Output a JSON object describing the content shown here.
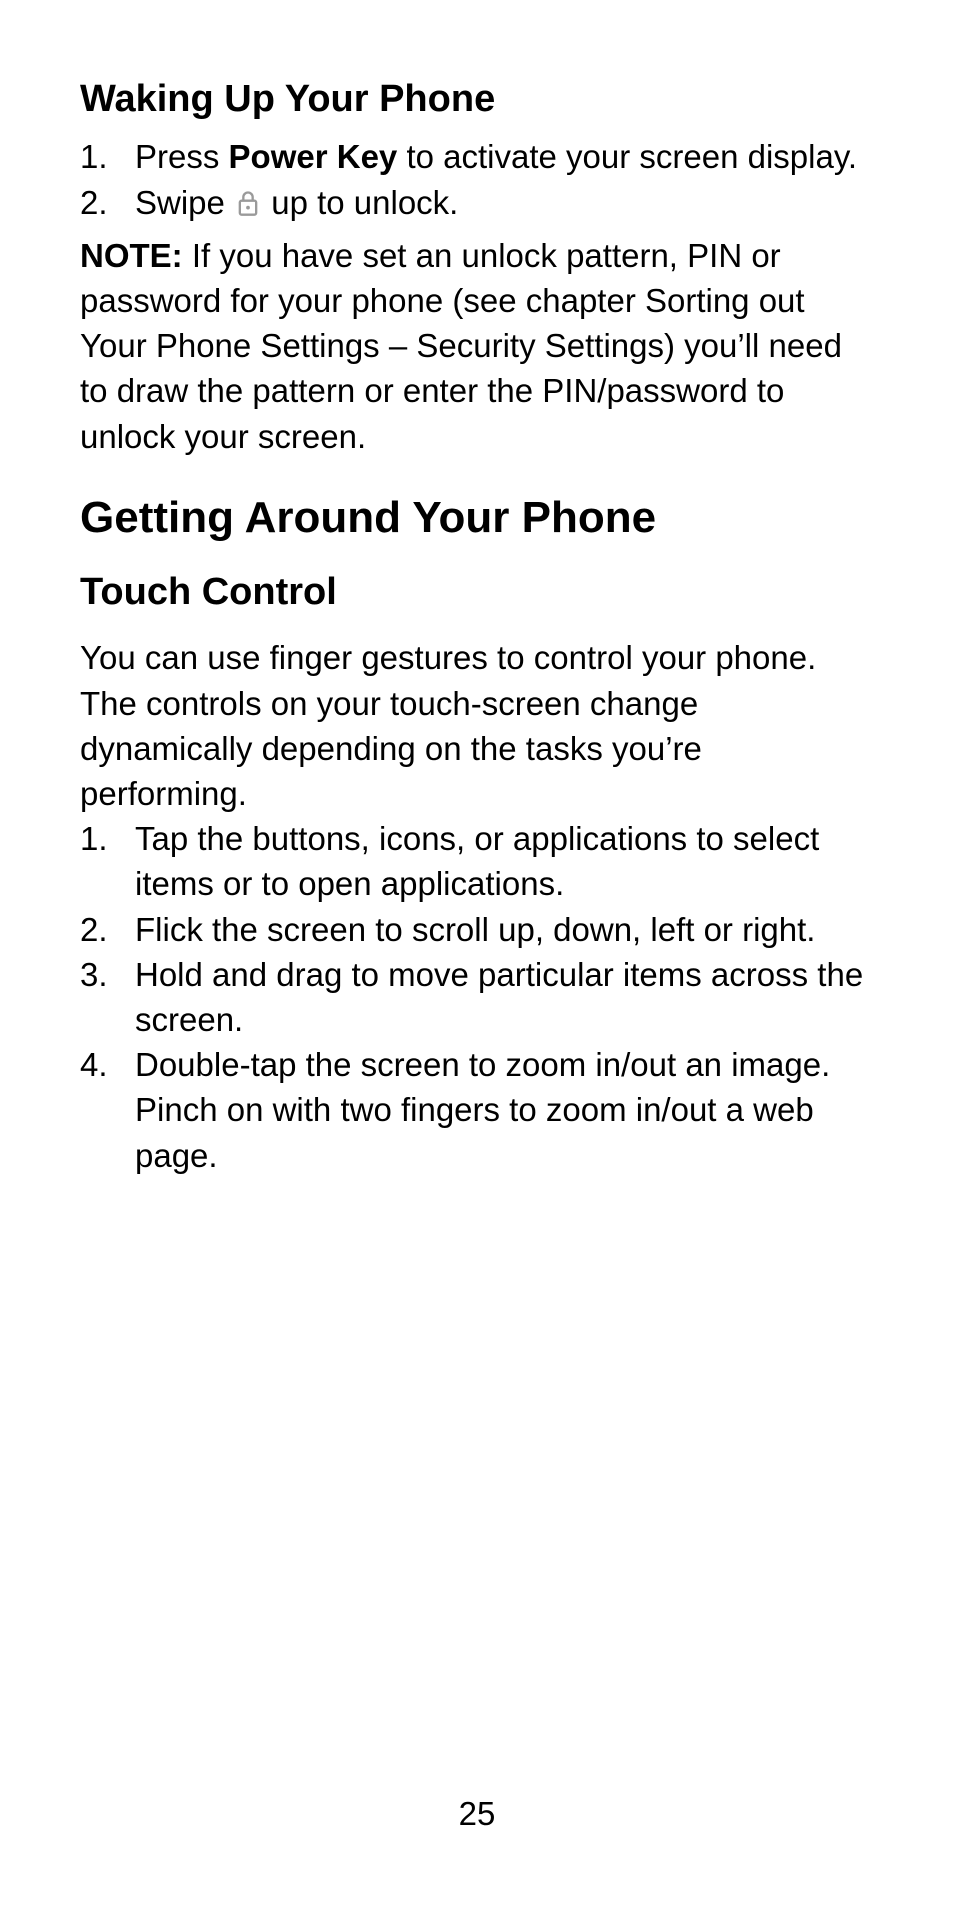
{
  "section1": {
    "heading": "Waking Up Your Phone",
    "items": [
      {
        "pre": "Press ",
        "bold": "Power Key",
        "post": " to activate your screen display."
      },
      {
        "pre": "Swipe ",
        "iconName": "lock-icon",
        "post": " up to unlock."
      }
    ]
  },
  "note": {
    "label": "NOTE:",
    "text": " If you have set an unlock pattern, PIN or password for your phone (see chapter Sorting out Your Phone Settings – Security Settings) you’ll need to draw the pattern or enter the PIN/password to unlock your screen."
  },
  "section2": {
    "heading": "Getting Around Your Phone",
    "sub": {
      "heading": "Touch Control",
      "intro": "You can use finger gestures to control your phone. The controls on your touch-screen change dynamically depending on the tasks you’re performing.",
      "items": [
        "Tap the buttons, icons, or applications to select items or to open applications.",
        "Flick the screen to scroll up, down, left or right.",
        "Hold and drag to move particular items across the screen.",
        "Double-tap the screen to zoom in/out an image. Pinch on with two fingers to zoom in/out a web page."
      ]
    }
  },
  "pageNumber": "25"
}
